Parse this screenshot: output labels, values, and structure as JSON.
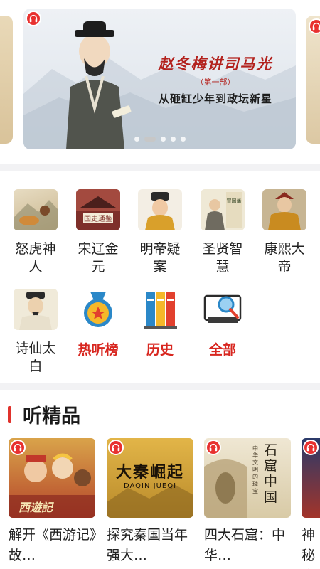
{
  "banner": {
    "title": "赵冬梅讲司马光",
    "subtitle": "（第一部）",
    "tagline": "从砸缸少年到政坛新星",
    "slides": 5,
    "active_slide": 1
  },
  "categories": [
    {
      "label": "怒虎神人",
      "icon": "tiger-painting-icon"
    },
    {
      "label": "宋辽金元",
      "icon": "palace-book-cover-icon"
    },
    {
      "label": "明帝疑案",
      "icon": "ming-emperor-portrait-icon"
    },
    {
      "label": "圣贤智慧",
      "icon": "sage-book-cover-icon"
    },
    {
      "label": "康熙大帝",
      "icon": "kangxi-portrait-icon"
    },
    {
      "label": "诗仙太白",
      "icon": "li-bai-portrait-icon"
    },
    {
      "label": "热听榜",
      "icon": "medal-icon"
    },
    {
      "label": "历史",
      "icon": "books-icon"
    },
    {
      "label": "全部",
      "icon": "search-monitor-icon"
    }
  ],
  "section": {
    "title": "听精品",
    "cards": [
      {
        "title": "解开《西游记》故…",
        "cover_text": "西遊記"
      },
      {
        "title": "探究秦国当年强大…",
        "cover_text": "大秦崛起",
        "cover_sub": "DAQIN JUEQI"
      },
      {
        "title": "四大石窟：中华…",
        "cover_text": "石窟中国",
        "cover_sub": "中华文明的瑰宝"
      },
      {
        "title": "神秘宫…",
        "cover_text": ""
      }
    ]
  },
  "colors": {
    "accent": "#e0322c",
    "banner_text": "#b3221e"
  }
}
